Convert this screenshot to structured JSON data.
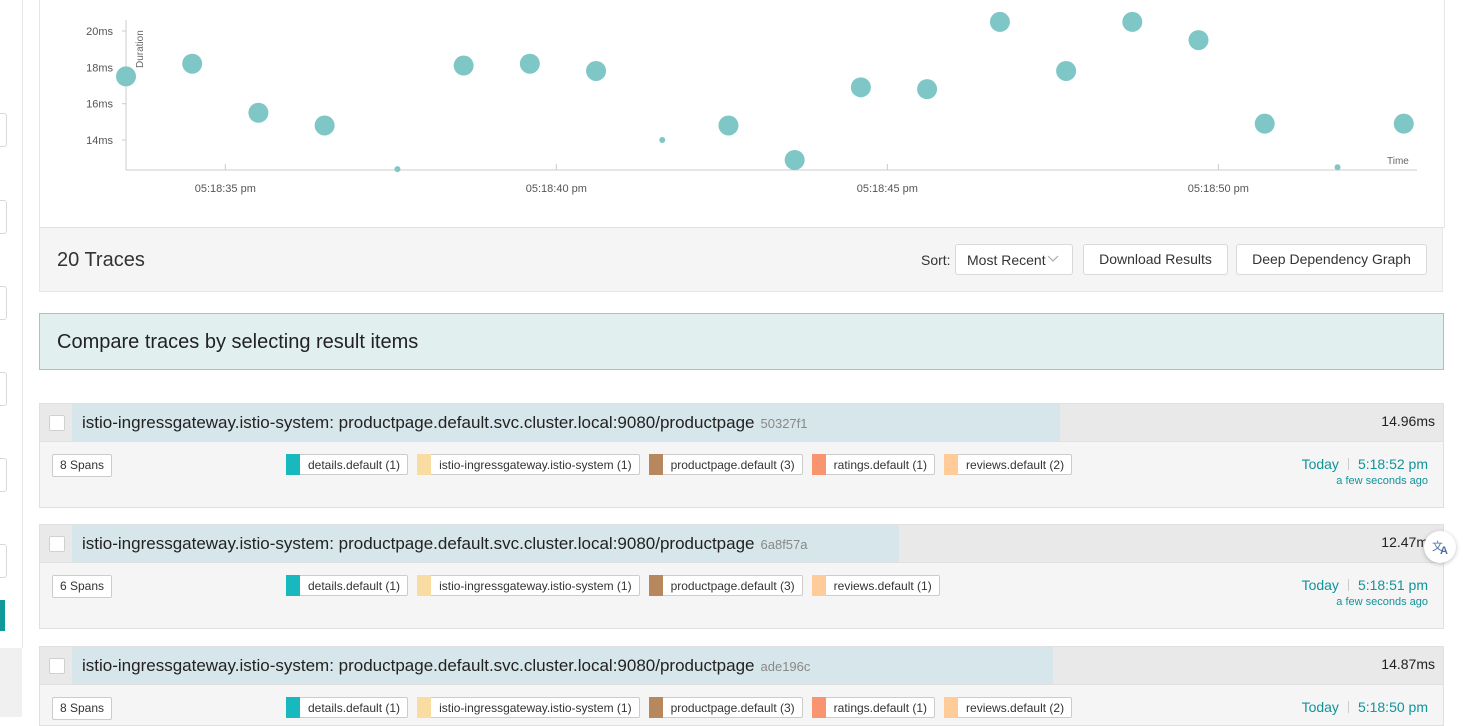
{
  "chart_data": {
    "type": "scatter",
    "ylabel": "Duration",
    "xlabel": "Time",
    "y_ticks": [
      "14ms",
      "16ms",
      "18ms",
      "20ms"
    ],
    "x_ticks": [
      "05:18:35 pm",
      "05:18:40 pm",
      "05:18:45 pm",
      "05:18:50 pm"
    ],
    "xlim_seconds": [
      33.5,
      53.0
    ],
    "ylim_ms": [
      12.4,
      20.6
    ],
    "points": [
      {
        "t": 33.5,
        "ms": 17.5,
        "spans": 8
      },
      {
        "t": 34.5,
        "ms": 18.2,
        "spans": 8
      },
      {
        "t": 35.5,
        "ms": 15.5,
        "spans": 8
      },
      {
        "t": 36.5,
        "ms": 14.8,
        "spans": 8
      },
      {
        "t": 37.6,
        "ms": 12.4,
        "spans": 1
      },
      {
        "t": 38.6,
        "ms": 18.1,
        "spans": 8
      },
      {
        "t": 39.6,
        "ms": 18.2,
        "spans": 8
      },
      {
        "t": 40.6,
        "ms": 17.8,
        "spans": 8
      },
      {
        "t": 41.6,
        "ms": 14.0,
        "spans": 1
      },
      {
        "t": 42.6,
        "ms": 14.8,
        "spans": 8
      },
      {
        "t": 43.6,
        "ms": 12.9,
        "spans": 8
      },
      {
        "t": 44.6,
        "ms": 16.9,
        "spans": 8
      },
      {
        "t": 45.6,
        "ms": 16.8,
        "spans": 8
      },
      {
        "t": 46.7,
        "ms": 20.5,
        "spans": 8
      },
      {
        "t": 47.7,
        "ms": 17.8,
        "spans": 8
      },
      {
        "t": 48.7,
        "ms": 20.5,
        "spans": 8
      },
      {
        "t": 49.7,
        "ms": 19.5,
        "spans": 8
      },
      {
        "t": 50.7,
        "ms": 14.9,
        "spans": 8
      },
      {
        "t": 51.8,
        "ms": 12.5,
        "spans": 1
      },
      {
        "t": 52.8,
        "ms": 14.9,
        "spans": 8
      }
    ],
    "point_color": "#7fc6c6"
  },
  "results": {
    "count_label": "20 Traces",
    "sort_label": "Sort:",
    "sort_value": "Most Recent",
    "download_label": "Download Results",
    "ddg_label": "Deep Dependency Graph"
  },
  "compare_banner": "Compare traces by selecting result items",
  "colors": {
    "details": "#17b8be",
    "gateway": "#f8dca1",
    "productpage": "#b7885e",
    "ratings": "#f89570",
    "reviews": "#ffcb99"
  },
  "traces": [
    {
      "title": "istio-ingressgateway.istio-system: productpage.default.svc.cluster.local:9080/productpage",
      "id": "50327f1",
      "duration": "14.96ms",
      "duration_fraction": 0.737,
      "spans": "8 Spans",
      "services": [
        "details.default (1)",
        "istio-ingressgateway.istio-system (1)",
        "productpage.default (3)",
        "ratings.default (1)",
        "reviews.default (2)"
      ],
      "day": "Today",
      "time": "5:18:52 pm",
      "relative": "a few seconds ago"
    },
    {
      "title": "istio-ingressgateway.istio-system: productpage.default.svc.cluster.local:9080/productpage",
      "id": "6a8f57a",
      "duration": "12.47ms",
      "duration_fraction": 0.617,
      "spans": "6 Spans",
      "services": [
        "details.default (1)",
        "istio-ingressgateway.istio-system (1)",
        "productpage.default (3)",
        "reviews.default (1)"
      ],
      "day": "Today",
      "time": "5:18:51 pm",
      "relative": "a few seconds ago"
    },
    {
      "title": "istio-ingressgateway.istio-system: productpage.default.svc.cluster.local:9080/productpage",
      "id": "ade196c",
      "duration": "14.87ms",
      "duration_fraction": 0.732,
      "spans": "8 Spans",
      "services": [
        "details.default (1)",
        "istio-ingressgateway.istio-system (1)",
        "productpage.default (3)",
        "ratings.default (1)",
        "reviews.default (2)"
      ],
      "day": "Today",
      "time": "5:18:50 pm",
      "relative": ""
    }
  ],
  "icons": {
    "sort_chevron": "chevron-down-icon",
    "translate": "translate-icon"
  }
}
